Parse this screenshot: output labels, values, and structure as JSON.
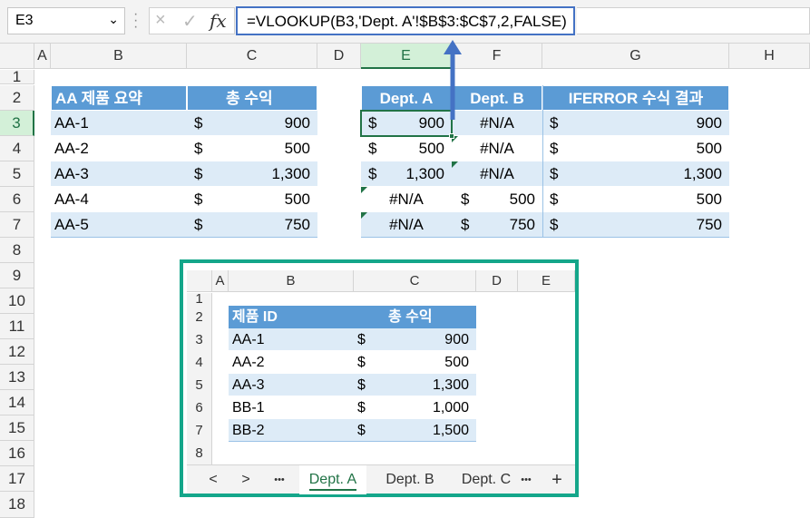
{
  "name_box": "E3",
  "formula": "=VLOOKUP(B3,'Dept. A'!$B$3:$C$7,2,FALSE)",
  "formula_icons": {
    "cancel": "×",
    "enter": "✓",
    "fx": "fx"
  },
  "columns": [
    "A",
    "B",
    "C",
    "D",
    "E",
    "F",
    "G",
    "H"
  ],
  "rows": [
    "1",
    "2",
    "3",
    "4",
    "5",
    "6",
    "7",
    "8",
    "9",
    "10",
    "11",
    "12",
    "13",
    "14",
    "15",
    "16",
    "17",
    "18"
  ],
  "summary": {
    "header_id": "AA 제품 요약",
    "header_rev": "총 수익",
    "rows": [
      {
        "id": "AA-1",
        "cur": "$",
        "val": "900"
      },
      {
        "id": "AA-2",
        "cur": "$",
        "val": "500"
      },
      {
        "id": "AA-3",
        "cur": "$",
        "val": "1,300"
      },
      {
        "id": "AA-4",
        "cur": "$",
        "val": "500"
      },
      {
        "id": "AA-5",
        "cur": "$",
        "val": "750"
      }
    ]
  },
  "lookup": {
    "header_a": "Dept. A",
    "header_b": "Dept. B",
    "header_result": "IFERROR 수식 결과",
    "rows": [
      {
        "a_cur": "$",
        "a": "900",
        "b_cur": "",
        "b": "#N/A",
        "r_cur": "$",
        "r": "900"
      },
      {
        "a_cur": "$",
        "a": "500",
        "b_cur": "",
        "b": "#N/A",
        "r_cur": "$",
        "r": "500"
      },
      {
        "a_cur": "$",
        "a": "1,300",
        "b_cur": "",
        "b": "#N/A",
        "r_cur": "$",
        "r": "1,300"
      },
      {
        "a_cur": "",
        "a": "#N/A",
        "b_cur": "$",
        "b": "500",
        "r_cur": "$",
        "r": "500"
      },
      {
        "a_cur": "",
        "a": "#N/A",
        "b_cur": "$",
        "b": "750",
        "r_cur": "$",
        "r": "750"
      }
    ]
  },
  "embedded": {
    "columns": [
      "A",
      "B",
      "C",
      "D",
      "E"
    ],
    "rows": [
      "1",
      "2",
      "3",
      "4",
      "5",
      "6",
      "7",
      "8"
    ],
    "header_id": "제품 ID",
    "header_rev": "총 수익",
    "data": [
      {
        "id": "AA-1",
        "cur": "$",
        "val": "900"
      },
      {
        "id": "AA-2",
        "cur": "$",
        "val": "500"
      },
      {
        "id": "AA-3",
        "cur": "$",
        "val": "1,300"
      },
      {
        "id": "BB-1",
        "cur": "$",
        "val": "1,000"
      },
      {
        "id": "BB-2",
        "cur": "$",
        "val": "1,500"
      }
    ],
    "tabs": {
      "prev": "<",
      "next": ">",
      "more": "•••",
      "tab1": "Dept. A",
      "tab2": "Dept. B",
      "tab3": "Dept. C",
      "more2": "•••",
      "add": "+"
    }
  },
  "colors": {
    "accent": "#4472c4",
    "header_fill": "#5b9bd5",
    "band_fill": "#ddebf7",
    "frame": "#14a68a",
    "excel_green": "#217346"
  }
}
